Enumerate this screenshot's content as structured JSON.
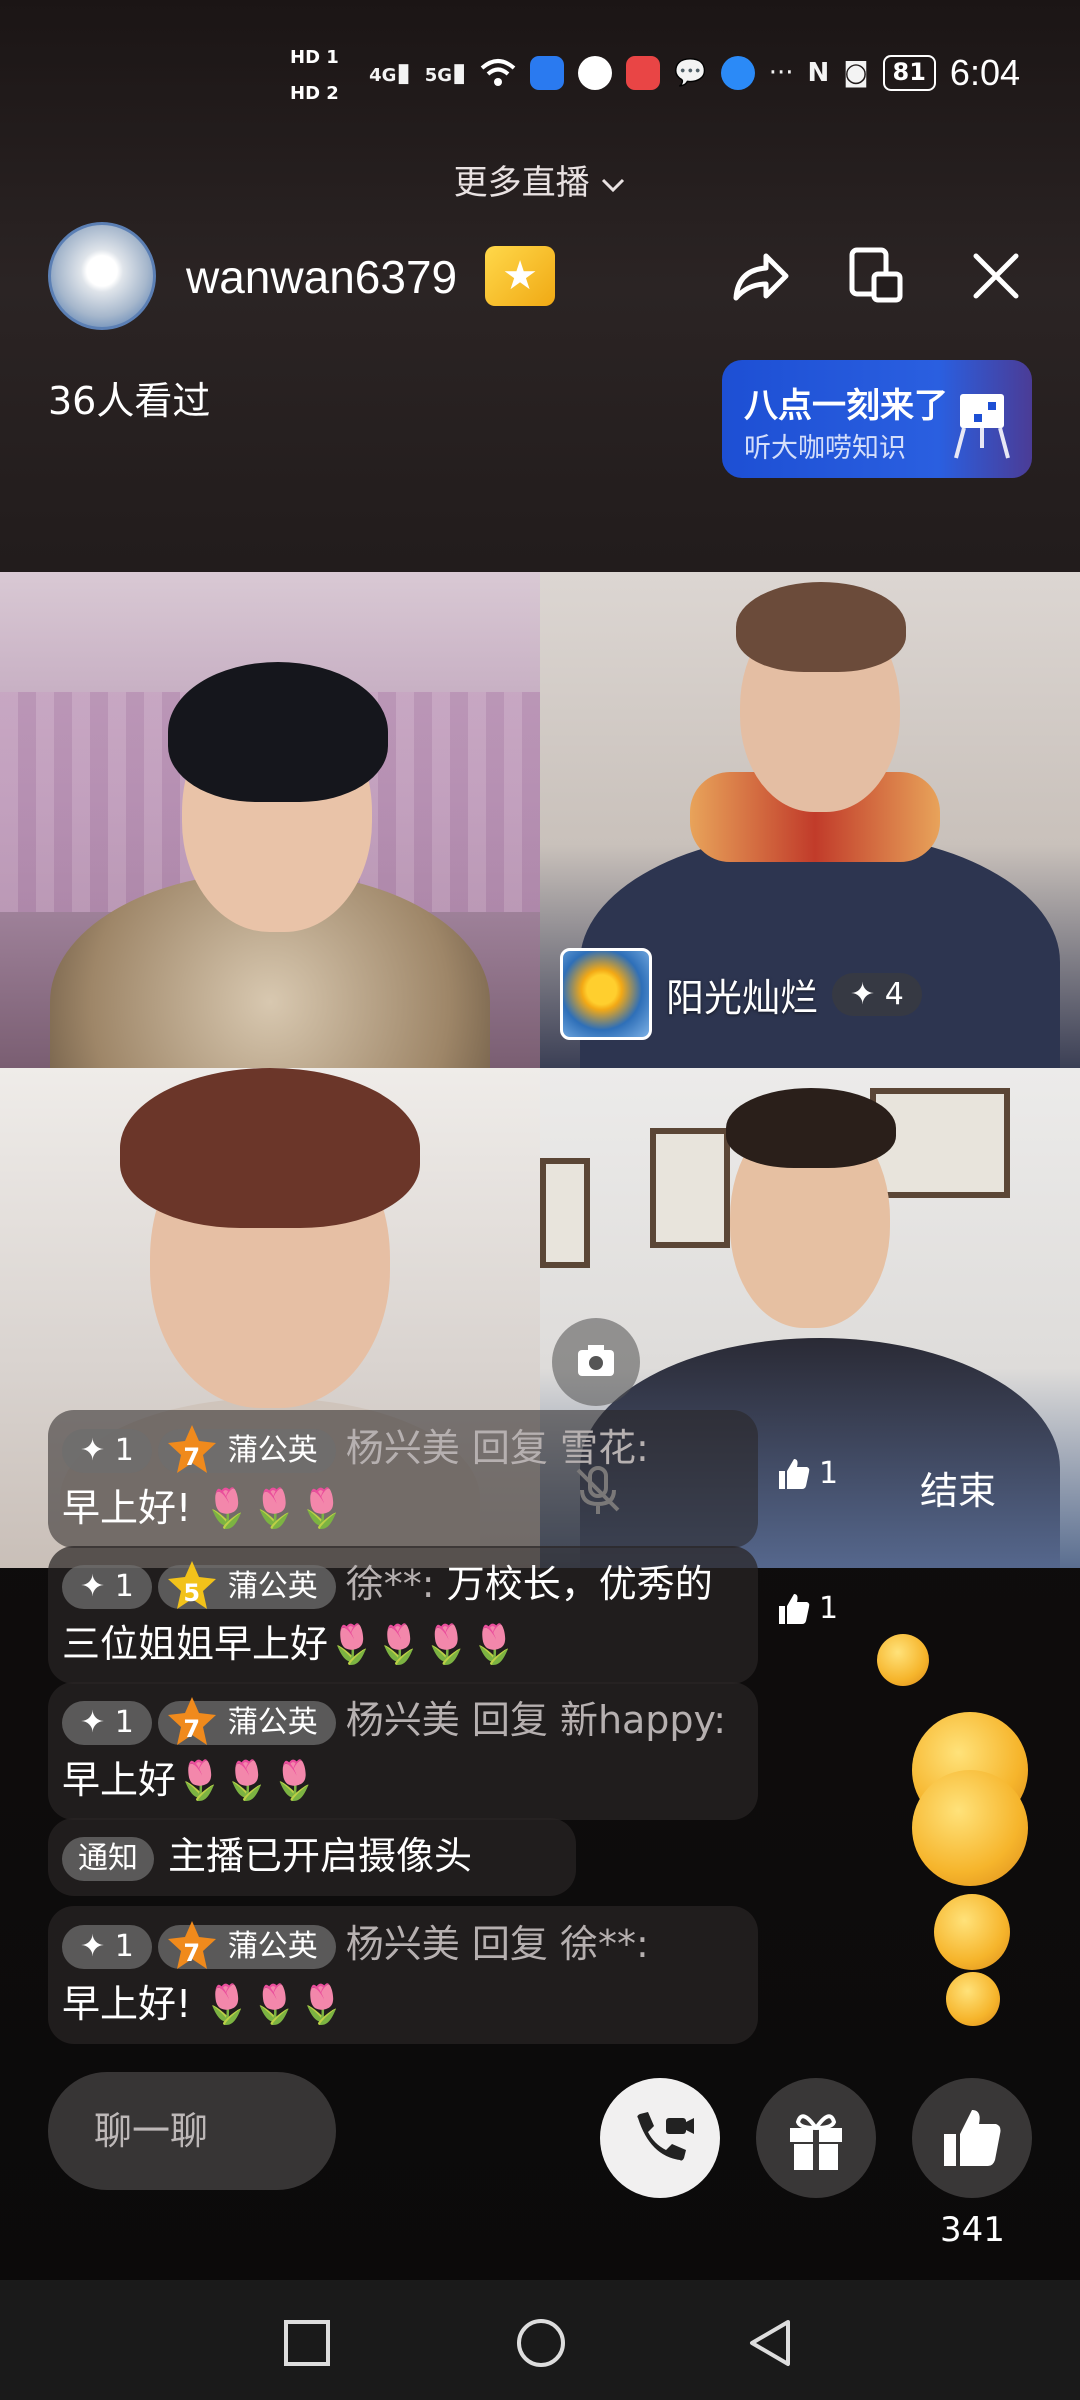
{
  "status_bar": {
    "hd1": "HD 1",
    "hd2": "HD 2",
    "network1": "4G",
    "network2": "5G",
    "battery": "81",
    "time": "6:04"
  },
  "header": {
    "more_live": "更多直播",
    "username": "wanwan6379",
    "viewers": "36人看过",
    "promo_title": "八点一刻来了",
    "promo_subtitle": "听大咖唠知识"
  },
  "video": {
    "tile_b_name": "阳光灿烂",
    "tile_b_level": "4",
    "end_label": "结束",
    "like_small_count": "1"
  },
  "comments": [
    {
      "level": "1",
      "fan_level": "7",
      "fan_name": "蒲公英",
      "user": "杨兴美 回复 雪花:",
      "text": "早上好! 🌷🌷🌷"
    },
    {
      "level": "1",
      "fan_level": "5",
      "fan_name": "蒲公英",
      "user": "徐**:",
      "text": "万校长，优秀的三位姐姐早上好🌷🌷🌷🌷"
    },
    {
      "level": "1",
      "fan_level": "7",
      "fan_name": "蒲公英",
      "user": "杨兴美 回复 新happy:",
      "text": "早上好🌷🌷🌷"
    },
    {
      "notice_label": "通知",
      "text": "主播已开启摄像头"
    },
    {
      "level": "1",
      "fan_level": "7",
      "fan_name": "蒲公英",
      "user": "杨兴美 回复 徐**:",
      "text": "早上好! 🌷🌷🌷"
    }
  ],
  "comment_like_count": "1",
  "bottom_bar": {
    "chat_placeholder": "聊一聊",
    "like_count": "341"
  }
}
